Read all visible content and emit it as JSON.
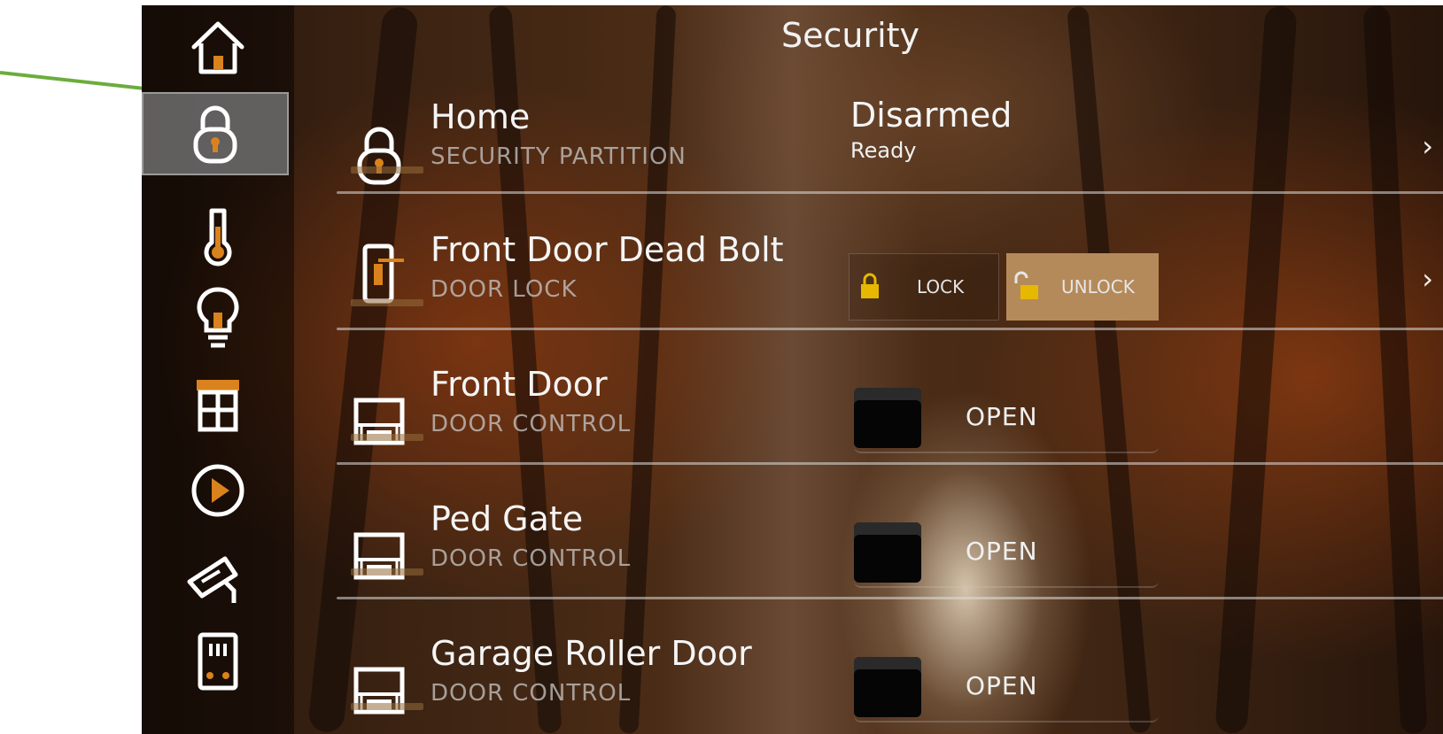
{
  "app": {
    "title": "Security"
  },
  "sidebar": {
    "items": [
      {
        "name": "home",
        "icon": "home-icon",
        "active": false
      },
      {
        "name": "security",
        "icon": "padlock-icon",
        "active": true
      },
      {
        "name": "climate",
        "icon": "thermometer-icon",
        "active": false
      },
      {
        "name": "lighting",
        "icon": "lightbulb-icon",
        "active": false
      },
      {
        "name": "shades",
        "icon": "window-shade-icon",
        "active": false
      },
      {
        "name": "media",
        "icon": "play-icon",
        "active": false
      },
      {
        "name": "cameras",
        "icon": "security-camera-icon",
        "active": false
      },
      {
        "name": "intercom",
        "icon": "intercom-icon",
        "active": false
      }
    ]
  },
  "rows": [
    {
      "name": "Home",
      "subtitle": "SECURITY PARTITION",
      "icon": "padlock-icon",
      "state": "Disarmed",
      "status": "Ready"
    },
    {
      "name": "Front Door Dead Bolt",
      "subtitle": "DOOR LOCK",
      "icon": "door-lock-icon",
      "lock_label": "LOCK",
      "unlock_label": "UNLOCK",
      "active": "unlock"
    },
    {
      "name": "Front Door",
      "subtitle": "DOOR CONTROL",
      "icon": "garage-door-icon",
      "action": "OPEN"
    },
    {
      "name": "Ped Gate",
      "subtitle": "DOOR CONTROL",
      "icon": "garage-door-icon",
      "action": "OPEN"
    },
    {
      "name": "Garage Roller Door",
      "subtitle": "DOOR CONTROL",
      "icon": "garage-door-icon",
      "action": "OPEN"
    }
  ],
  "colors": {
    "accent": "#d9821e",
    "unlock_active_bg": "#b58a5a",
    "annotation_arrow": "#6aad3c",
    "icon_stroke": "#ffffff"
  }
}
